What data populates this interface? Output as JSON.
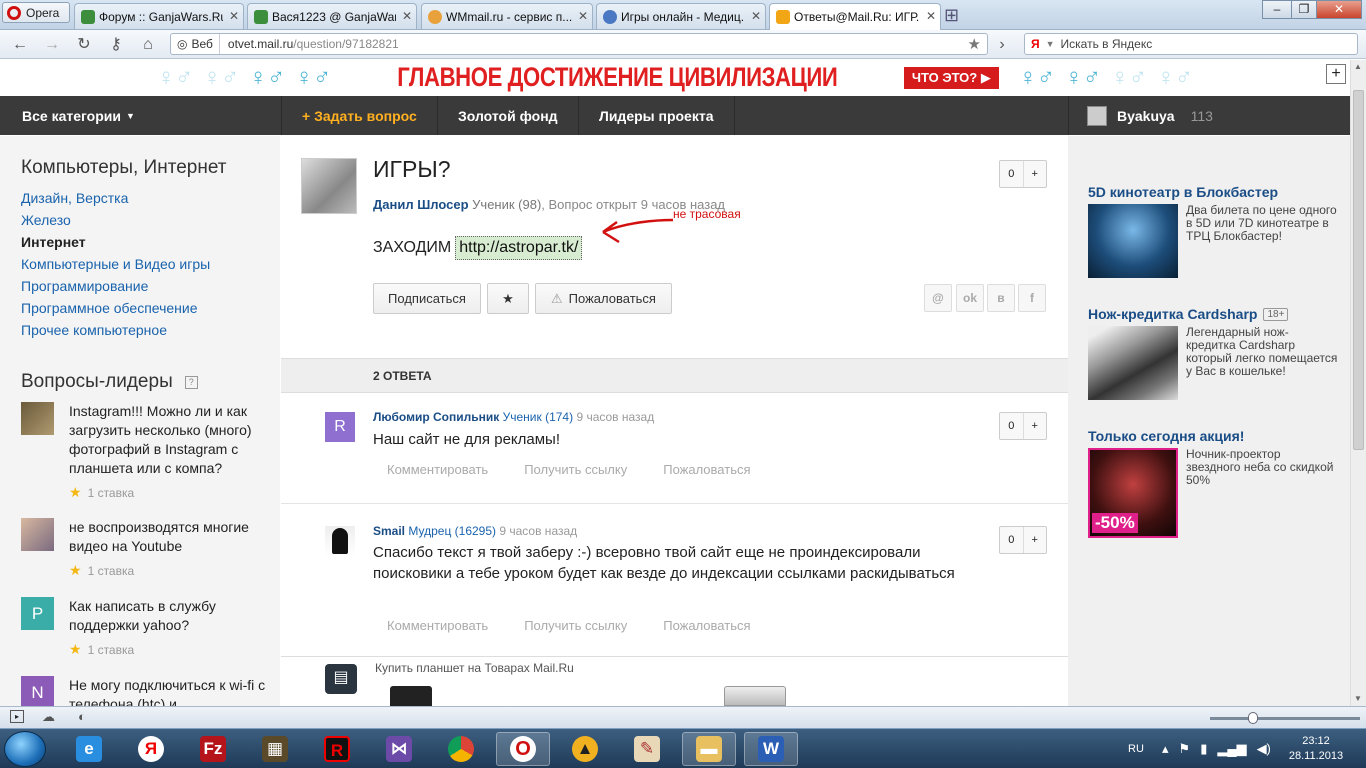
{
  "browser": {
    "menu_label": "Opera",
    "tabs": [
      {
        "title": "Форум :: GanjaWars.Ru...",
        "active": false
      },
      {
        "title": "Вася1223 @ GanjaWars...",
        "active": false
      },
      {
        "title": "WMmail.ru - сервис п...",
        "active": false
      },
      {
        "title": "Игры онлайн - Медиц...",
        "active": false
      },
      {
        "title": "Ответы@Mail.Ru: ИГР...",
        "active": true
      }
    ],
    "url_scheme_label": "Веб",
    "url_host": "otvet.mail.ru",
    "url_path": "/question/97182821",
    "search_engine": "Я",
    "search_placeholder": "Искать в Яндекс"
  },
  "banner": {
    "text": "ГЛАВНОЕ ДОСТИЖЕНИЕ ЦИВИЛИЗАЦИИ",
    "button": "ЧТО ЭТО?"
  },
  "nav": {
    "categories": "Все категории",
    "ask": "+ Задать вопрос",
    "gold": "Золотой фонд",
    "leaders": "Лидеры проекта",
    "user_name": "Byakuya",
    "user_points": "113"
  },
  "sidebar": {
    "category_title": "Компьютеры, Интернет",
    "categories": [
      {
        "label": "Дизайн, Верстка",
        "current": false
      },
      {
        "label": "Железо",
        "current": false
      },
      {
        "label": "Интернет",
        "current": true
      },
      {
        "label": "Компьютерные и Видео игры",
        "current": false
      },
      {
        "label": "Программирование",
        "current": false
      },
      {
        "label": "Программное обеспечение",
        "current": false
      },
      {
        "label": "Прочее компьютерное",
        "current": false
      }
    ],
    "leaders_title": "Вопросы-лидеры",
    "leaders_help": "?",
    "questions": [
      {
        "text": "Instagram!!! Можно ли и как загрузить несколько (много) фотографий в Instagram с планшета или с компа?",
        "stat": "1 ставка",
        "avatar": ""
      },
      {
        "text": "не воспроизводятся многие видео на Youtube",
        "stat": "1 ставка",
        "avatar": ""
      },
      {
        "text": "Как написать в службу поддержки yahoo?",
        "stat": "1 ставка",
        "avatar": "P"
      },
      {
        "text": "Не могу подключиться к wi-fi с телефона (htc) и",
        "stat": "",
        "avatar": "N"
      }
    ]
  },
  "question": {
    "title": "ИГРЫ?",
    "author": "Данил Шлосер",
    "rank": "Ученик (98)",
    "opened": ", Вопрос открыт 9 часов назад",
    "body_prefix": "ЗАХОДИМ",
    "link": "http://astropar.tk/",
    "annotation": "не трасовая",
    "votes": "0",
    "plus": "+",
    "subscribe": "Подписаться",
    "star": "★",
    "report": "Пожаловаться",
    "share": [
      "@",
      "ok",
      "в",
      "f"
    ]
  },
  "answers": {
    "count_label": "2 ОТВЕТА",
    "items": [
      {
        "avatar": "R",
        "author": "Любомир Сопильник",
        "rank": "Ученик (174)",
        "time": "9 часов назад",
        "text": "Наш сайт не для рекламы!",
        "votes": "0"
      },
      {
        "avatar": "",
        "author": "Smail",
        "rank": "Мудрец (16295)",
        "time": "9 часов назад",
        "text": "Спасибо текст я твой заберу :-) всеровно твой сайт еще не проиндексировали поисковики а тебе уроком будет как везде до индексации ссылками раскидываться",
        "votes": "0"
      }
    ],
    "comment": "Комментировать",
    "getlink": "Получить ссылку",
    "report": "Пожаловаться"
  },
  "promo": {
    "text": "Купить планшет на Товарах Mail.Ru"
  },
  "ads": [
    {
      "title": "5D кинотеатр в Блокбастер",
      "badge": "",
      "text": "Два билета по цене одного в 5D или 7D кинотеатре в ТРЦ Блокбастер!"
    },
    {
      "title": "Нож-кредитка Cardsharp",
      "badge": "18+",
      "text": "Легендарный нож-кредитка Cardsharp который легко помещается у Вас в кошельке!"
    },
    {
      "title": "Только сегодня акция!",
      "badge": "",
      "text": "Ночник-проектор звездного неба со скидкой 50%",
      "sale": "-50%"
    }
  ],
  "taskbar": {
    "lang": "RU",
    "time": "23:12",
    "date": "28.11.2013"
  },
  "colors": {
    "accent": "#1a63ad",
    "nav_bg": "#3a3a3a",
    "ask": "#ffb020",
    "banner_red": "#e02020"
  }
}
